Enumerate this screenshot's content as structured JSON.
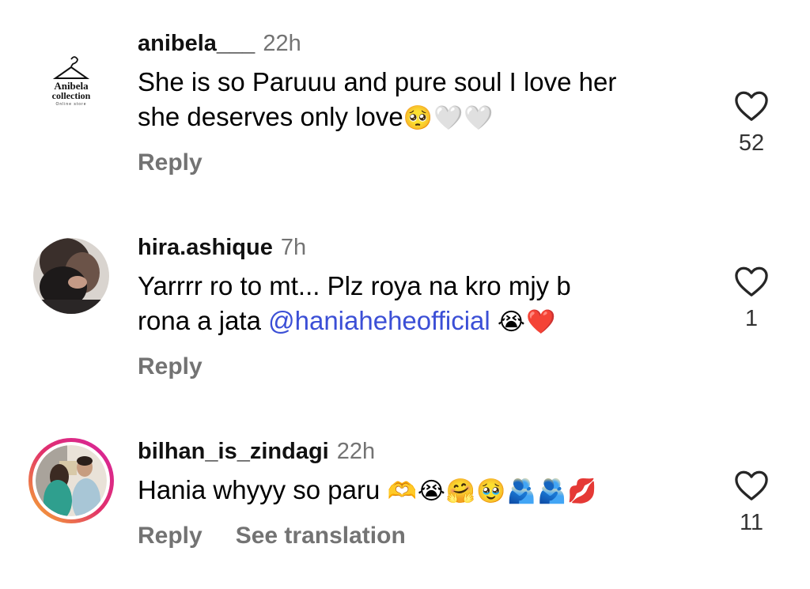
{
  "comments": [
    {
      "username": "anibela___",
      "time": "22h",
      "text": "She is so Paruuu and pure soul I love her\nshe deserves only love",
      "emojis": "🥺🤍🤍",
      "reply_label": "Reply",
      "likes": "52",
      "avatar": {
        "type": "logo",
        "brand_line1": "Anibela",
        "brand_line2": "collection",
        "brand_line3": "Online store"
      }
    },
    {
      "username": "hira.ashique",
      "time": "7h",
      "text_before_mention": "Yarrrr ro to mt... Plz roya na kro mjy b\nrona a jata ",
      "mention": "@haniaheheofficial",
      "emojis": "😭❤️",
      "reply_label": "Reply",
      "likes": "1",
      "avatar": {
        "type": "photo"
      }
    },
    {
      "username": "bilhan_is_zindagi",
      "time": "22h",
      "text": "Hania whyyy so paru ",
      "emojis": "🫶😭🤗🥹🫂🫂💋",
      "reply_label": "Reply",
      "translate_label": "See translation",
      "likes": "11",
      "avatar": {
        "type": "photo",
        "story_ring": true
      }
    }
  ],
  "colors": {
    "username": "#111111",
    "secondary": "#737373",
    "mention": "#3b4fd6",
    "story_ring_start": "#f7b52c",
    "story_ring_end": "#d6249f"
  },
  "icons": {
    "like": "heart-outline-icon"
  }
}
